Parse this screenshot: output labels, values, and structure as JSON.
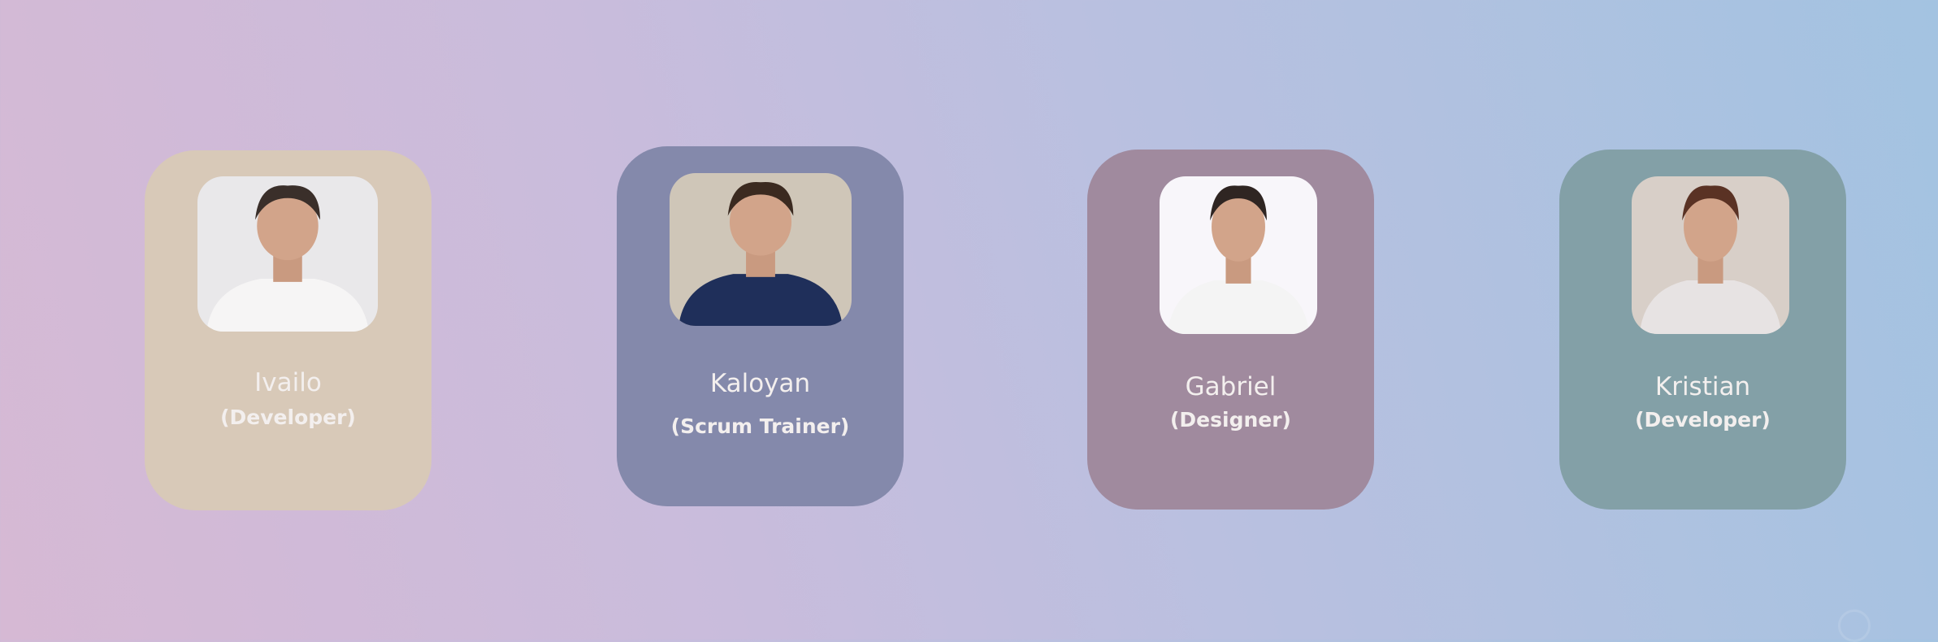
{
  "team": [
    {
      "name": "Ivailo",
      "role": "(Developer)",
      "card_color": "#d8c9b8",
      "photo_bg": "#e9e8ea",
      "shirt": "#f6f5f5",
      "hair": "#3a2f2a"
    },
    {
      "name": "Kaloyan",
      "role": "(Scrum Trainer)",
      "card_color": "#8489ab",
      "photo_bg": "#cfc6b8",
      "shirt": "#1f2f5a",
      "hair": "#3b2a20"
    },
    {
      "name": "Gabriel",
      "role": "(Designer)",
      "card_color": "#a08a9e",
      "photo_bg": "#f8f6fa",
      "shirt": "#f4f4f4",
      "hair": "#2f2522"
    },
    {
      "name": "Kristian",
      "role": "(Developer)",
      "card_color": "#83a0a7",
      "photo_bg": "#d8cfc8",
      "shirt": "#e7e3e3",
      "hair": "#5a3224"
    }
  ]
}
